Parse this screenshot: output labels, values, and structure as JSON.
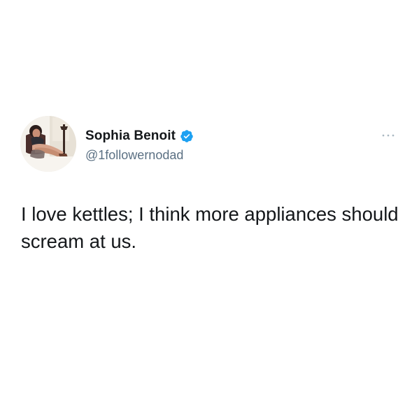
{
  "tweet": {
    "author": {
      "display_name": "Sophia Benoit",
      "handle": "@1followernodad",
      "verified": true,
      "avatar_icon": "profile-photo"
    },
    "text": "I love kettles; I think more appliances should scream at us.",
    "more_icon": "more-horizontal-icon"
  },
  "colors": {
    "background": "#ffffff",
    "text": "#14171a",
    "secondary_text": "#5b7083",
    "verified_badge": "#1da1f2",
    "more_icon": "#aab8c2"
  }
}
